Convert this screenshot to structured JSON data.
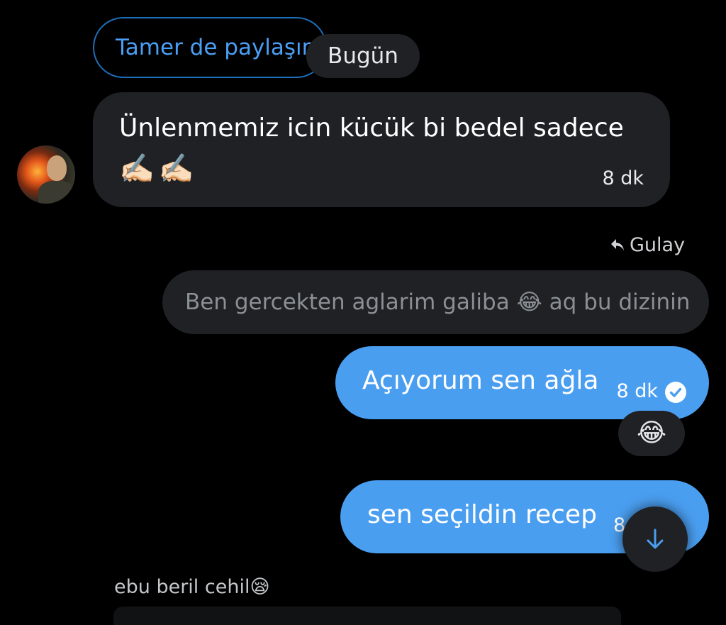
{
  "shared_pill": {
    "label": "Tamer de paylaşır"
  },
  "date_separator": {
    "label": "Bugün"
  },
  "incoming_message": {
    "text": "Ünlenmemiz icin kücük bi bedel sadece",
    "emoji": "✍🏻✍🏻",
    "time": "8 dk"
  },
  "reply": {
    "label": "Gulay",
    "icon": "reply-arrow-icon"
  },
  "quoted_message": {
    "text": "Ben gercekten aglarim galiba 😂 aq bu dizinin"
  },
  "outgoing_messages": [
    {
      "text": "Açıyorum sen ağla",
      "time": "8 dk",
      "status_icon": "check-circle-icon",
      "reaction": "😂"
    },
    {
      "text": "sen seçildin recep",
      "time": "8"
    }
  ],
  "scroll_button": {
    "icon": "arrow-down-icon"
  },
  "next_preview": {
    "text": "ebu beril cehil😪"
  },
  "colors": {
    "background": "#000000",
    "bubble_incoming": "#1f2124",
    "bubble_outgoing": "#4a9ef0",
    "accent": "#4a9ff5"
  }
}
